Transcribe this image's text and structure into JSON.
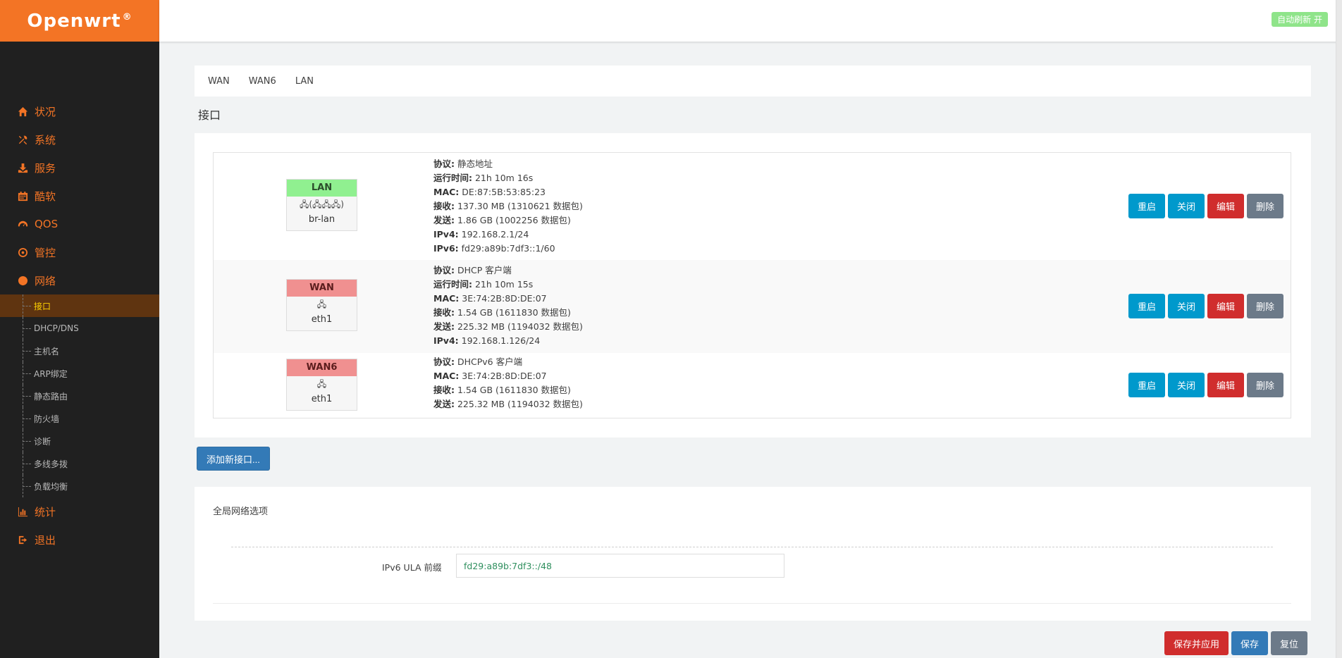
{
  "brand": {
    "name": "Openwrt",
    "mark": "®"
  },
  "header": {
    "auto_refresh": "自动刷新 开"
  },
  "menu": [
    {
      "label": "状况",
      "icon": "home-icon"
    },
    {
      "label": "系统",
      "icon": "tools-icon"
    },
    {
      "label": "服务",
      "icon": "download-icon"
    },
    {
      "label": "酷软",
      "icon": "calendar-icon"
    },
    {
      "label": "QOS",
      "icon": "gauge-icon"
    },
    {
      "label": "管控",
      "icon": "target-icon"
    },
    {
      "label": "网络",
      "icon": "globe-icon"
    }
  ],
  "network_sub": [
    "接口",
    "DHCP/DNS",
    "主机名",
    "ARP绑定",
    "静态路由",
    "防火墙",
    "诊断",
    "多线多拨",
    "负载均衡"
  ],
  "menu_bottom": [
    {
      "label": "统计",
      "icon": "bar-chart-icon"
    },
    {
      "label": "退出",
      "icon": "logout-icon"
    }
  ],
  "tabs": [
    "WAN",
    "WAN6",
    "LAN"
  ],
  "section_title": "接口",
  "interfaces": [
    {
      "name": "LAN",
      "icons": "🖧(🖧🖧🖧)",
      "device": "br-lan",
      "lines": [
        {
          "k": "协议:",
          "v": " 静态地址"
        },
        {
          "k": "运行时间:",
          "v": " 21h 10m 16s"
        },
        {
          "k": "MAC:",
          "v": " DE:87:5B:53:85:23"
        },
        {
          "k": "接收:",
          "v": " 137.30 MB (1310621 数据包)"
        },
        {
          "k": "发送:",
          "v": " 1.86 GB (1002256 数据包)"
        },
        {
          "k": "IPv4:",
          "v": " 192.168.2.1/24"
        },
        {
          "k": "IPv6:",
          "v": " fd29:a89b:7df3::1/60"
        }
      ]
    },
    {
      "name": "WAN",
      "icons": "🖧",
      "device": "eth1",
      "lines": [
        {
          "k": "协议:",
          "v": " DHCP 客户端"
        },
        {
          "k": "运行时间:",
          "v": " 21h 10m 15s"
        },
        {
          "k": "MAC:",
          "v": " 3E:74:2B:8D:DE:07"
        },
        {
          "k": "接收:",
          "v": " 1.54 GB (1611830 数据包)"
        },
        {
          "k": "发送:",
          "v": " 225.32 MB (1194032 数据包)"
        },
        {
          "k": "IPv4:",
          "v": " 192.168.1.126/24"
        }
      ]
    },
    {
      "name": "WAN6",
      "icons": "🖧",
      "device": "eth1",
      "lines": [
        {
          "k": "协议:",
          "v": " DHCPv6 客户端"
        },
        {
          "k": "MAC:",
          "v": " 3E:74:2B:8D:DE:07"
        },
        {
          "k": "接收:",
          "v": " 1.54 GB (1611830 数据包)"
        },
        {
          "k": "发送:",
          "v": " 225.32 MB (1194032 数据包)"
        }
      ]
    }
  ],
  "row_buttons": {
    "restart": "重启",
    "stop": "关闭",
    "edit": "编辑",
    "delete": "删除"
  },
  "add_interface": "添加新接口...",
  "global": {
    "title": "全局网络选项",
    "ula_label": "IPv6 ULA 前缀",
    "ula_value": "fd29:a89b:7df3::/48"
  },
  "footer": {
    "save_apply": "保存并应用",
    "save": "保存",
    "reset": "复位"
  },
  "colors": {
    "accent": "#f37425",
    "sidebar": "#202020",
    "blue_btn": "#0099cc",
    "red_btn": "#d02d2d",
    "grey_btn": "#6c7a89"
  }
}
